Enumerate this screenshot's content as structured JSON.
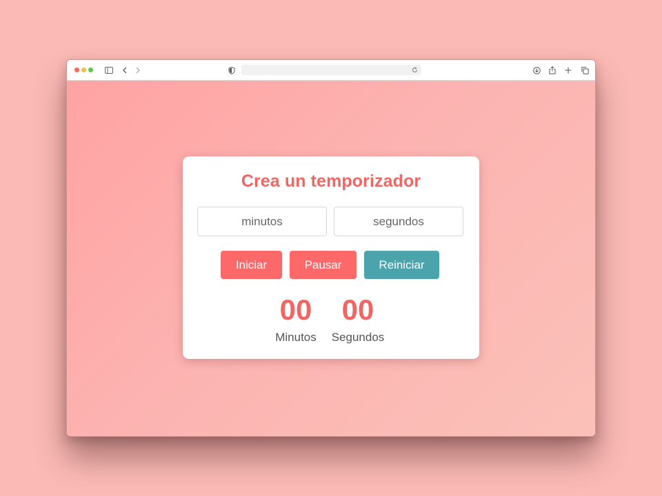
{
  "browser": {
    "icons": {
      "sidebar": "sidebar-icon",
      "back": "chevron-left-icon",
      "forward": "chevron-right-icon",
      "privacy": "shield-icon",
      "reload": "reload-icon",
      "download": "download-icon",
      "share": "share-icon",
      "new_tab": "plus-icon",
      "tabs": "tabs-icon"
    },
    "address": ""
  },
  "timer": {
    "title": "Crea un temporizador",
    "minutes_placeholder": "minutos",
    "seconds_placeholder": "segundos",
    "start_label": "Iniciar",
    "pause_label": "Pausar",
    "reset_label": "Reiniciar",
    "minutes_value": "00",
    "seconds_value": "00",
    "minutes_label": "Minutos",
    "seconds_label": "Segundos"
  },
  "colors": {
    "accent": "#f26563",
    "button_primary": "#fd6868",
    "button_reset": "#4ba3ab",
    "background": "#fbbab5"
  }
}
